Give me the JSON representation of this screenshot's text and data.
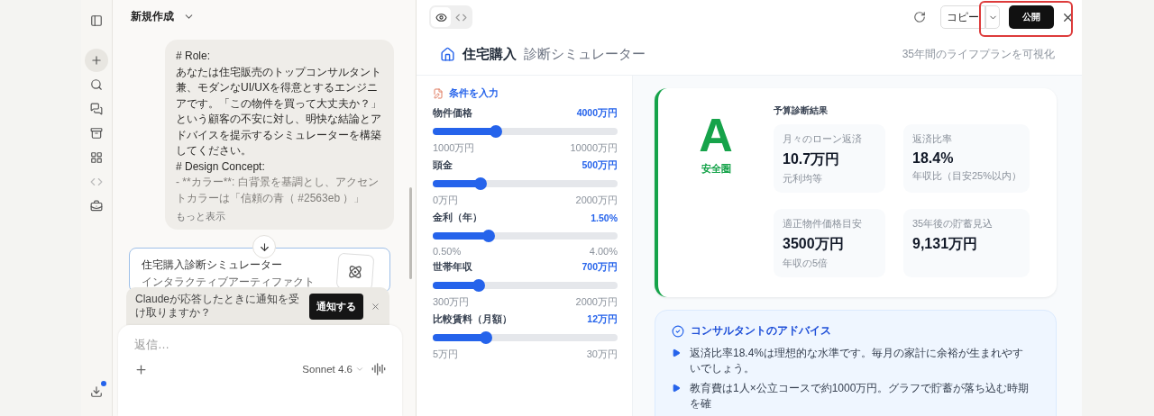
{
  "rail": {
    "download_badge": true
  },
  "chat": {
    "title": "新規作成",
    "message": {
      "paragraphs": [
        {
          "kind": "text",
          "text": "# Role:"
        },
        {
          "kind": "text",
          "text": "あなたは住宅販売のトップコンサルタント兼、モダンなUI/UXを得意とするエンジニアです。「この物件を買って大丈夫か？」という顧客の不安に対し、明快な結論とアドバイスを提示するシミュレーターを構築してください。"
        },
        {
          "kind": "text",
          "text": "# Design Concept:"
        },
        {
          "kind": "faded",
          "text": "- **カラー**: 白背景を基調とし、アクセントカラーは「信頼の青（ #2563eb ）」"
        }
      ],
      "more": "もっと表示"
    },
    "artifact": {
      "title": "住宅購入診断シミュレーター",
      "subtitle": "インタラクティブアーティファクト"
    },
    "notice": {
      "text": "Claudeが応答したときに通知を受け取りますか？",
      "button": "通知する"
    },
    "composer": {
      "placeholder": "返信…",
      "model": "Sonnet 4.6"
    }
  },
  "panel": {
    "view_tabs": [
      {
        "kind": "preview",
        "selected": true
      },
      {
        "kind": "code",
        "selected": false
      }
    ],
    "copy": "コピー",
    "publish": "公開",
    "header": {
      "title": "住宅購入",
      "subtitle": "診断シミュレーター",
      "tagline": "35年間のライフプランを可視化"
    },
    "inputs": {
      "title": "条件を入力",
      "sliders": [
        {
          "label": "物件価格",
          "value": "4000万円",
          "level": 0.34,
          "min": "1000万円",
          "max": "10000万円"
        },
        {
          "label": "頭金",
          "value": "500万円",
          "level": 0.26,
          "min": "0万円",
          "max": "2000万円"
        },
        {
          "label": "金利（年）",
          "value": "1.50%",
          "level": 0.3,
          "min": "0.50%",
          "max": "4.00%"
        },
        {
          "label": "世帯年収",
          "value": "700万円",
          "level": 0.25,
          "min": "300万円",
          "max": "2000万円"
        },
        {
          "label": "比較賃料（月額）",
          "value": "12万円",
          "level": 0.29,
          "min": "5万円",
          "max": "30万円"
        }
      ]
    },
    "result": {
      "grade": "A",
      "grade_label": "安全圏",
      "color": "#16a34a",
      "title": "予算診断結果",
      "metrics": [
        {
          "label": "月々のローン返済",
          "value": "10.7万円",
          "note": "元利均等"
        },
        {
          "label": "返済比率",
          "value": "18.4%",
          "note": "年収比（目安25%以内）"
        },
        {
          "label": "適正物件価格目安",
          "value": "3500万円",
          "note": "年収の5倍"
        },
        {
          "label": "35年後の貯蓄見込",
          "value": "9,131万円"
        }
      ]
    },
    "advice": {
      "title": "コンサルタントのアドバイス",
      "items": [
        "返済比率18.4%は理想的な水準です。毎月の家計に余裕が生まれやすいでしょう。",
        "教育費は1人×公立コースで約1000万円。グラフで貯蓄が落ち込む時期を確"
      ]
    }
  }
}
